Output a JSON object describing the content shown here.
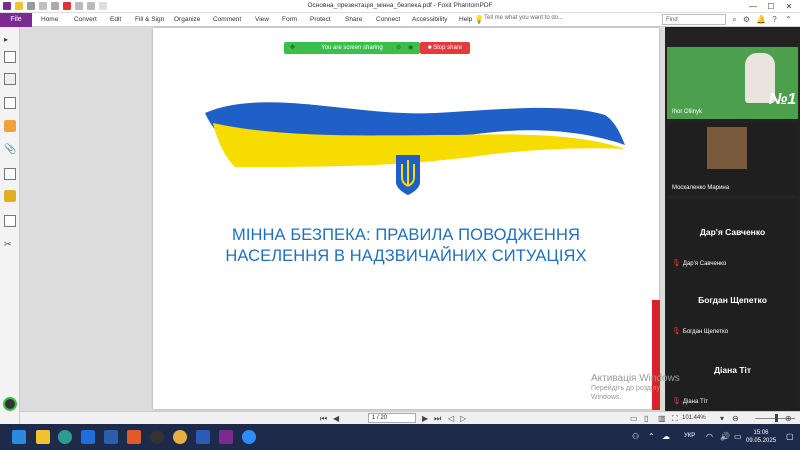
{
  "window": {
    "title": "Основна_презентація_мінна_безпека.pdf - Foxit PhantomPDF",
    "minimize": "—",
    "maximize": "☐",
    "close": "✕"
  },
  "menu": {
    "file": "File",
    "items": [
      "Home",
      "Convert",
      "Edit",
      "Fill & Sign",
      "Organize",
      "Comment",
      "View",
      "Form",
      "Protect",
      "Share",
      "Connect",
      "Accessibility",
      "Help"
    ],
    "tell_me": "Tell me what you want to do...",
    "find_placeholder": "Find"
  },
  "screen_share": {
    "status": "You are screen sharing",
    "stop": "Stop share"
  },
  "slide": {
    "title_line1": "МІННА БЕЗПЕКА: ПРАВИЛА ПОВОДЖЕННЯ",
    "title_line2": "НАСЕЛЕННЯ В НАДЗВИЧАЙНИХ СИТУАЦІЯХ"
  },
  "participants": [
    {
      "name": "Ihor Oliinyk",
      "label": "Ihor Oliinyk",
      "video": true
    },
    {
      "name": "Москаленко Марина",
      "label": "Москаленко Марина",
      "video": true
    },
    {
      "name": "Дар'я Савченко",
      "label": "Дар'я Савченко",
      "video": false
    },
    {
      "name": "Богдан Щепетко",
      "label": "Богдан Щепетко",
      "video": false
    },
    {
      "name": "Діана Тіт",
      "label": "Діана Тіт",
      "video": false
    }
  ],
  "tile1_text": {
    "line1": "№1"
  },
  "page_nav": {
    "page": "1 / 20",
    "zoom": "101.44%"
  },
  "watermark": {
    "line1": "Активація Windows",
    "line2": "Перейдіть до розділу",
    "line3": "Windows."
  },
  "taskbar": {
    "lang": "УКР",
    "time": "15:06",
    "date": "09.05.2025"
  },
  "colors": {
    "accent_purple": "#7b2a8f",
    "slide_blue": "#1f6fc0",
    "flag_blue": "#1f5fc8",
    "flag_yellow": "#f7dc00",
    "share_green": "#3bbf4a",
    "stop_red": "#e33b3b"
  }
}
